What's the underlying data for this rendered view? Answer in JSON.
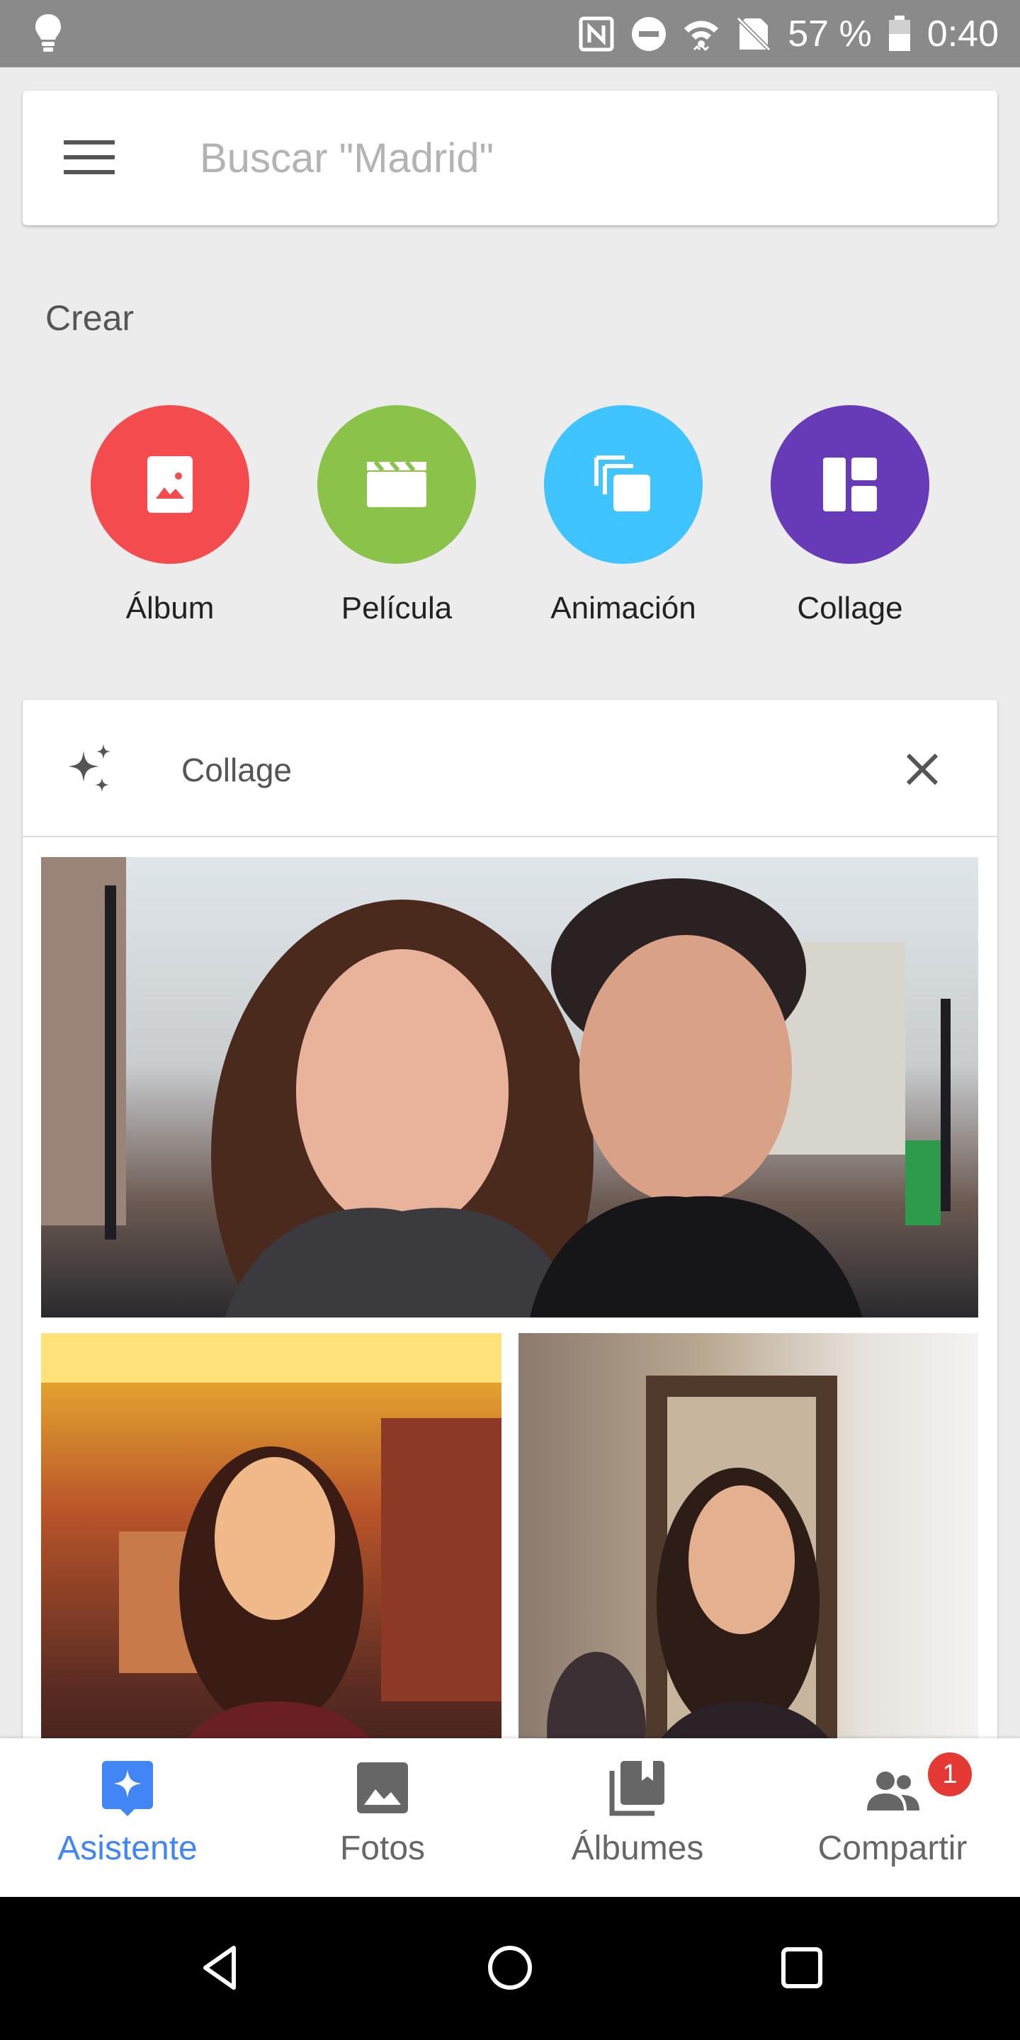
{
  "status_bar": {
    "battery_percent": "57 %",
    "time": "0:40",
    "icons": [
      "lightbulb-icon",
      "nfc-icon",
      "do-not-disturb-icon",
      "wifi-icon",
      "no-sim-icon",
      "battery-icon"
    ]
  },
  "search": {
    "placeholder": "Buscar \"Madrid\"",
    "value": ""
  },
  "create": {
    "title": "Crear",
    "items": [
      {
        "label": "Álbum",
        "color": "#f44b4f",
        "icon": "album-icon"
      },
      {
        "label": "Película",
        "color": "#8bc34a",
        "icon": "movie-icon"
      },
      {
        "label": "Animación",
        "color": "#40c4ff",
        "icon": "animation-icon"
      },
      {
        "label": "Collage",
        "color": "#673ab7",
        "icon": "collage-icon"
      }
    ]
  },
  "card": {
    "title": "Collage",
    "icon": "sparkle-icon",
    "close_icon": "close-icon"
  },
  "bottom_nav": {
    "items": [
      {
        "label": "Asistente",
        "icon": "assistant-icon",
        "active": true
      },
      {
        "label": "Fotos",
        "icon": "photos-icon",
        "active": false
      },
      {
        "label": "Álbumes",
        "icon": "albums-icon",
        "active": false
      },
      {
        "label": "Compartir",
        "icon": "share-icon",
        "active": false,
        "badge": "1"
      }
    ]
  },
  "colors": {
    "accent": "#4285f4",
    "badge": "#e53935",
    "status_bar": "#8a8a8a"
  }
}
